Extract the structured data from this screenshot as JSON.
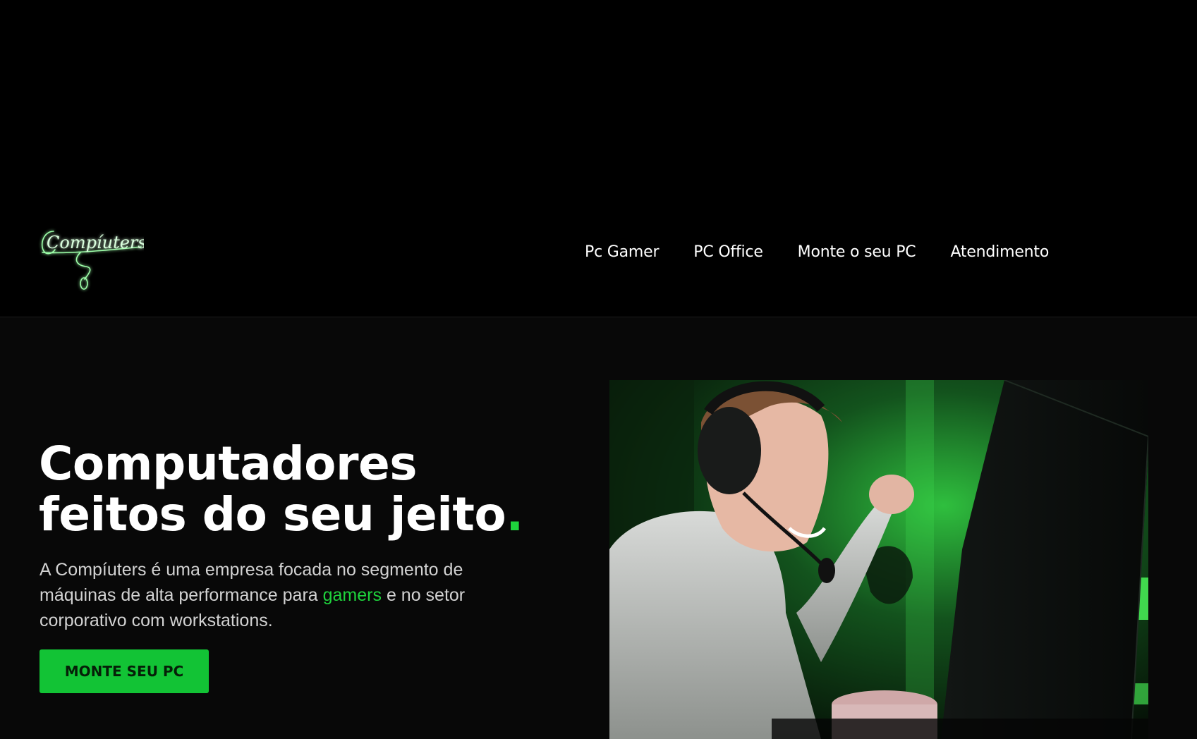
{
  "header": {
    "logo": {
      "text": "Compíuters",
      "icon": "mouse-cable-logo-icon"
    },
    "nav": [
      {
        "label": "Pc Gamer"
      },
      {
        "label": "PC Office"
      },
      {
        "label": "Monte o seu PC"
      },
      {
        "label": "Atendimento"
      }
    ]
  },
  "hero": {
    "title_line1": "Computadores",
    "title_line2": "feitos do seu jeito",
    "title_dot": ".",
    "description_part1": "A Compíuters é uma empresa focada no segmento de máquinas de alta performance para ",
    "description_highlight": "gamers",
    "description_part2": " e no setor corporativo com workstations.",
    "cta_label": "MONTE SEU PC",
    "image_icon": "gamer-boy-photo"
  },
  "colors": {
    "accent": "#1ed33c",
    "button": "#12c335",
    "background": "#000000",
    "hero_background": "#080808"
  }
}
